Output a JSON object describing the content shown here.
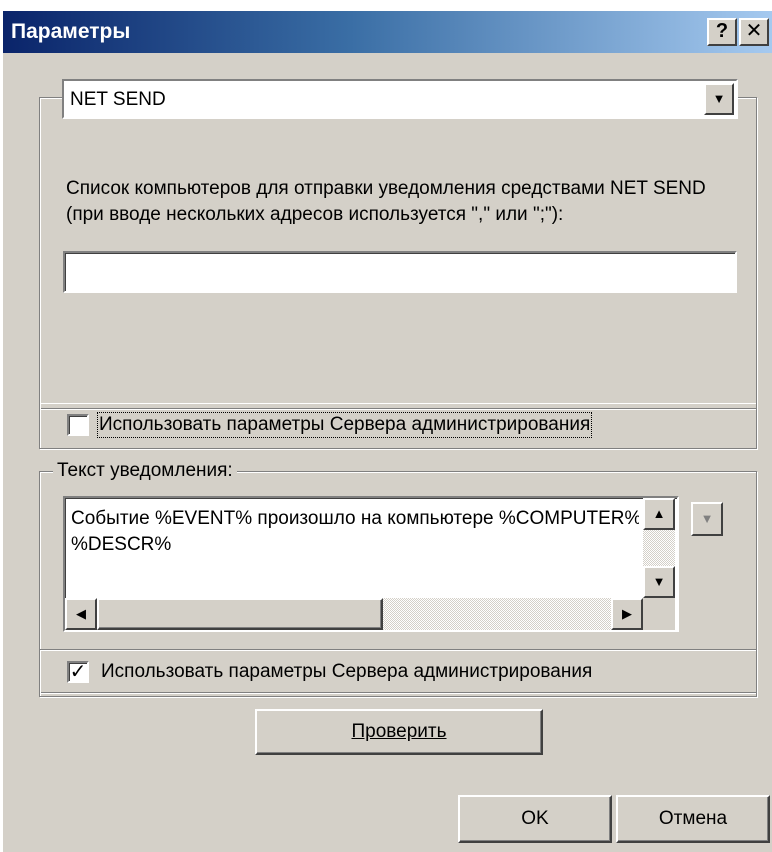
{
  "window": {
    "title": "Параметры",
    "help_label": "?",
    "close_label": "✕"
  },
  "method": {
    "selected": "NET SEND"
  },
  "netsend": {
    "description": "Список компьютеров для отправки уведомления средствами NET SEND (при вводе нескольких адресов используется \",\" или \";\"):",
    "addresses": ""
  },
  "use_server_params_1": {
    "label": "Использовать параметры Сервера администрирования",
    "checked": false
  },
  "notification": {
    "group_label": "Текст уведомления:",
    "line1": "Событие %EVENT% произошло на компьютере %COMPUTER%",
    "line2": "%DESCR%"
  },
  "use_server_params_2": {
    "label": "Использовать параметры Сервера администрирования",
    "checked": true
  },
  "buttons": {
    "check": "Проверить",
    "ok": "OK",
    "cancel": "Отмена"
  },
  "colors": {
    "title_start": "#0a246a",
    "title_end": "#a6caf0",
    "face": "#d4d0c8"
  }
}
